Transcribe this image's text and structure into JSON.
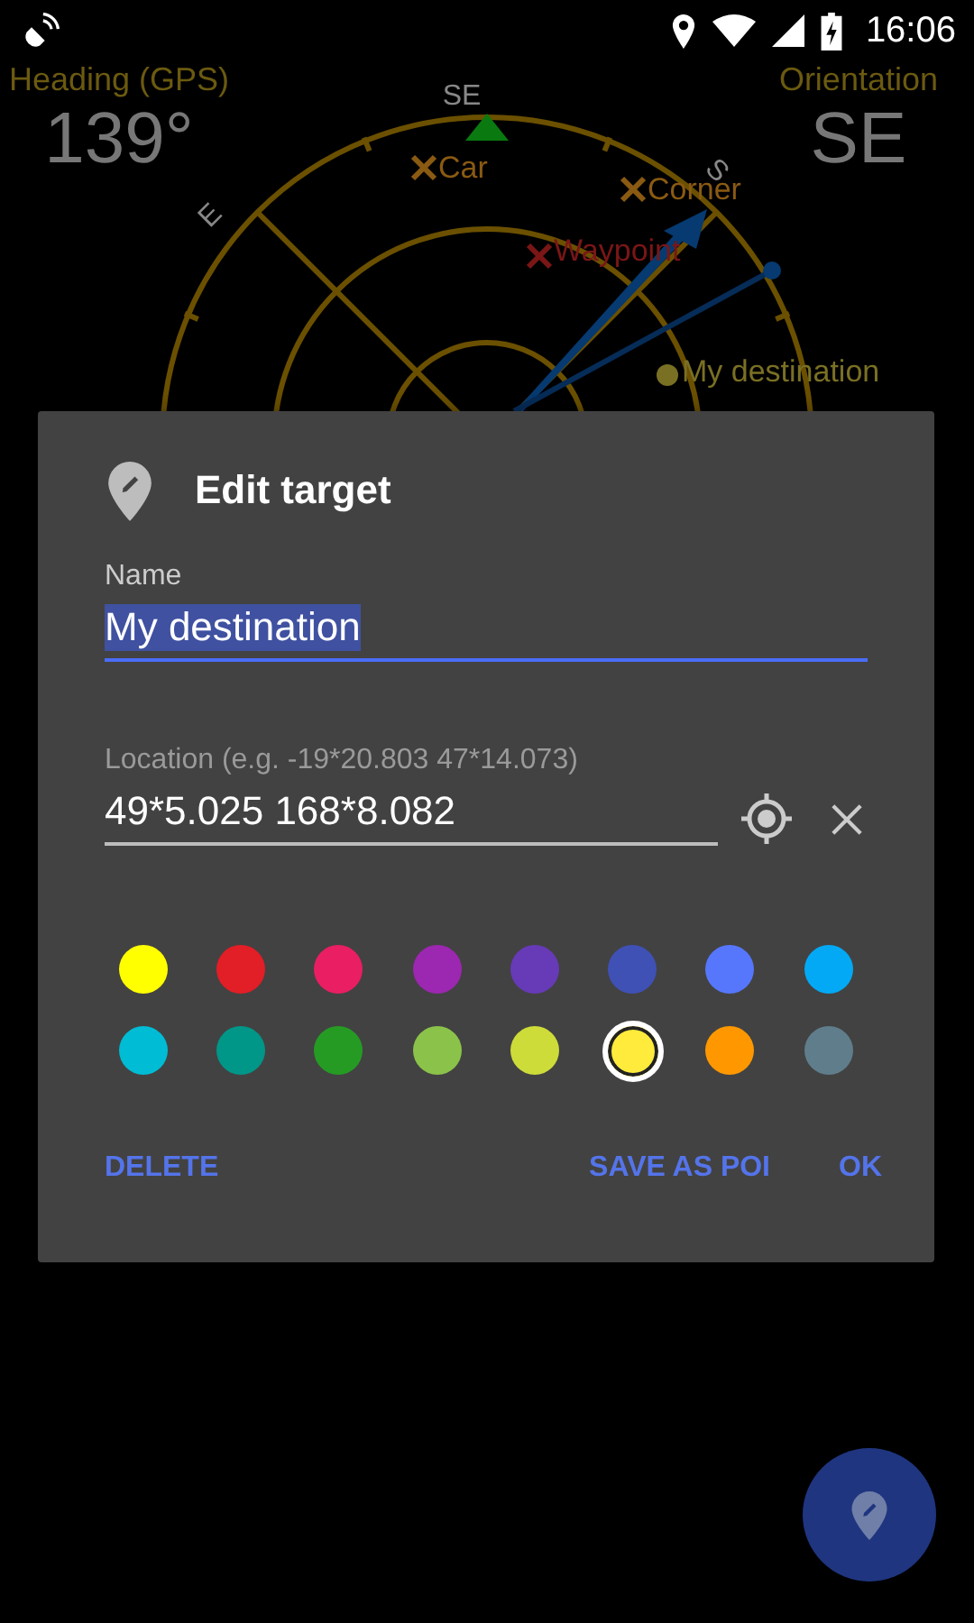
{
  "status_bar": {
    "time": "16:06"
  },
  "heading": {
    "label": "Heading (GPS)",
    "value": "139°"
  },
  "orientation": {
    "label": "Orientation",
    "value": "SE"
  },
  "compass": {
    "cardinals": [
      "SE",
      "E",
      "S"
    ],
    "targets": [
      {
        "label": "Car",
        "kind": "cross",
        "color": "#8a5a12"
      },
      {
        "label": "Corner",
        "kind": "cross",
        "color": "#8a5a12"
      },
      {
        "label": "Waypoint",
        "kind": "cross",
        "color": "#7a1616"
      },
      {
        "label": "My destination",
        "kind": "dot",
        "color": "#7a7024"
      }
    ]
  },
  "dialog": {
    "title": "Edit target",
    "name_field": {
      "label": "Name",
      "value": "My destination",
      "focused": true
    },
    "location_field": {
      "label": "Location (e.g. -19*20.803 47*14.073)",
      "value": "49*5.025 168*8.082"
    },
    "colors": [
      {
        "color": "#ffff00",
        "selected": false
      },
      {
        "color": "#e21e26",
        "selected": false
      },
      {
        "color": "#e91e63",
        "selected": false
      },
      {
        "color": "#9c27b0",
        "selected": false
      },
      {
        "color": "#673ab7",
        "selected": false
      },
      {
        "color": "#3f51b5",
        "selected": false
      },
      {
        "color": "#5677fc",
        "selected": false
      },
      {
        "color": "#03a9f4",
        "selected": false
      },
      {
        "color": "#00bcd4",
        "selected": false
      },
      {
        "color": "#009688",
        "selected": false
      },
      {
        "color": "#259b24",
        "selected": false
      },
      {
        "color": "#8bc34a",
        "selected": false
      },
      {
        "color": "#cddc39",
        "selected": false
      },
      {
        "color": "#ffeb3b",
        "selected": true
      },
      {
        "color": "#ff9800",
        "selected": false
      },
      {
        "color": "#607d8b",
        "selected": false
      }
    ],
    "buttons": [
      {
        "label": "DELETE",
        "kind": "left"
      },
      {
        "label": "SAVE AS POI",
        "kind": "right"
      },
      {
        "label": "OK",
        "kind": "right"
      }
    ]
  }
}
